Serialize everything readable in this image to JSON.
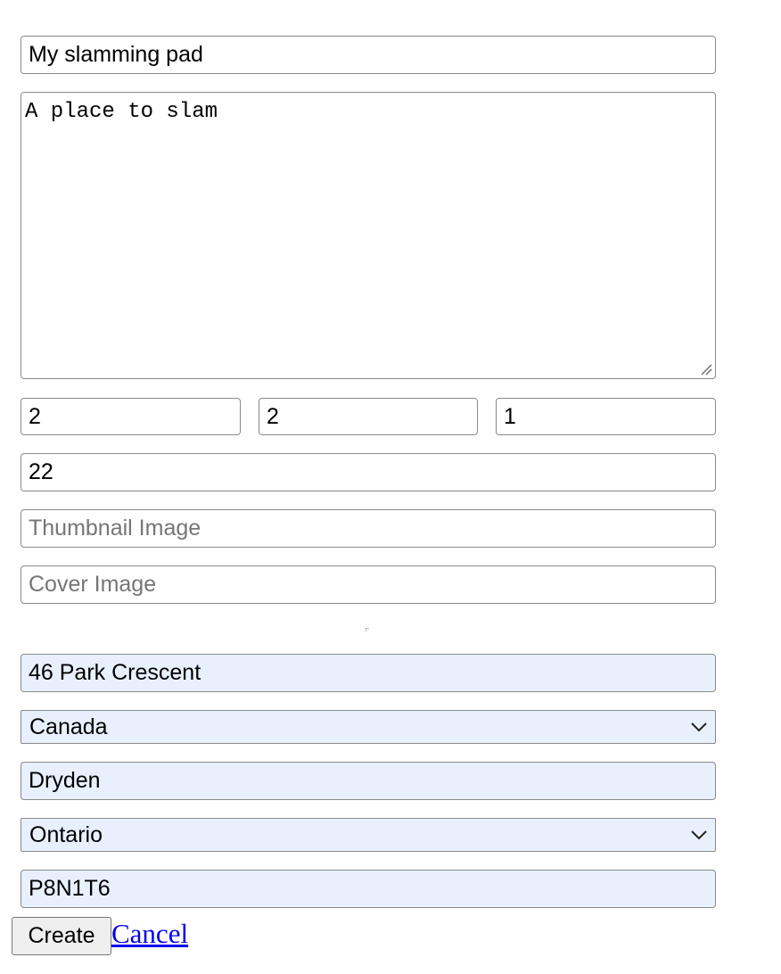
{
  "form": {
    "title_value": "My slamming pad",
    "description_value": "A place to slam",
    "count_1_value": "2",
    "count_2_value": "2",
    "count_3_value": "1",
    "number_value": "22",
    "thumbnail_placeholder": "Thumbnail Image",
    "cover_placeholder": "Cover Image",
    "address_value": "46 Park Crescent",
    "country_value": "Canada",
    "city_value": "Dryden",
    "province_value": "Ontario",
    "postal_value": "P8N1T6"
  },
  "actions": {
    "create_label": "Create",
    "cancel_label": "Cancel"
  },
  "colors": {
    "autofill_bg": "#e8f0fe",
    "link": "#0000ee"
  }
}
